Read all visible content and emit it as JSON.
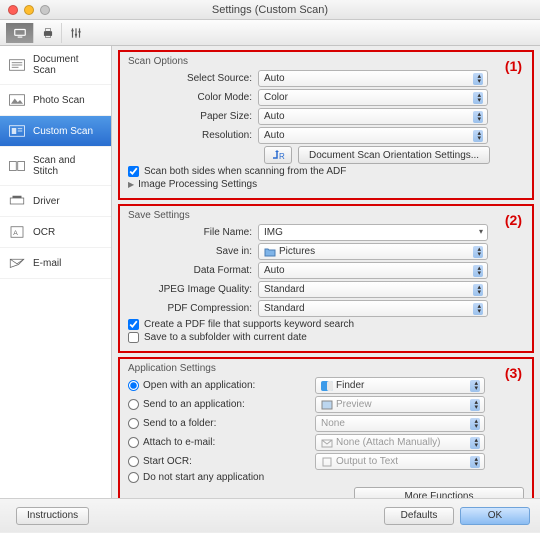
{
  "window": {
    "title": "Settings (Custom Scan)"
  },
  "sidebar": {
    "items": [
      {
        "label": "Document Scan"
      },
      {
        "label": "Photo Scan"
      },
      {
        "label": "Custom Scan"
      },
      {
        "label": "Scan and Stitch"
      },
      {
        "label": "Driver"
      },
      {
        "label": "OCR"
      },
      {
        "label": "E-mail"
      }
    ]
  },
  "annotations": {
    "one": "(1)",
    "two": "(2)",
    "three": "(3)"
  },
  "scan_options": {
    "title": "Scan Options",
    "select_source_label": "Select Source:",
    "select_source_value": "Auto",
    "color_mode_label": "Color Mode:",
    "color_mode_value": "Color",
    "paper_size_label": "Paper Size:",
    "paper_size_value": "Auto",
    "resolution_label": "Resolution:",
    "resolution_value": "Auto",
    "orientation_button": "Document Scan Orientation Settings...",
    "scan_both_sides": "Scan both sides when scanning from the ADF",
    "image_processing": "Image Processing Settings"
  },
  "save_settings": {
    "title": "Save Settings",
    "file_name_label": "File Name:",
    "file_name_value": "IMG",
    "save_in_label": "Save in:",
    "save_in_value": "Pictures",
    "data_format_label": "Data Format:",
    "data_format_value": "Auto",
    "jpeg_quality_label": "JPEG Image Quality:",
    "jpeg_quality_value": "Standard",
    "pdf_compression_label": "PDF Compression:",
    "pdf_compression_value": "Standard",
    "create_pdf": "Create a PDF file that supports keyword search",
    "save_subfolder": "Save to a subfolder with current date"
  },
  "app_settings": {
    "title": "Application Settings",
    "open_with": "Open with an application:",
    "open_with_value": "Finder",
    "send_to_app": "Send to an application:",
    "send_to_app_value": "Preview",
    "send_to_folder": "Send to a folder:",
    "send_to_folder_value": "None",
    "attach_email": "Attach to e-mail:",
    "attach_email_value": "None (Attach Manually)",
    "start_ocr": "Start OCR:",
    "start_ocr_value": "Output to Text",
    "do_not_start": "Do not start any application",
    "more_functions": "More Functions"
  },
  "footer": {
    "instructions": "Instructions",
    "defaults": "Defaults",
    "ok": "OK"
  }
}
